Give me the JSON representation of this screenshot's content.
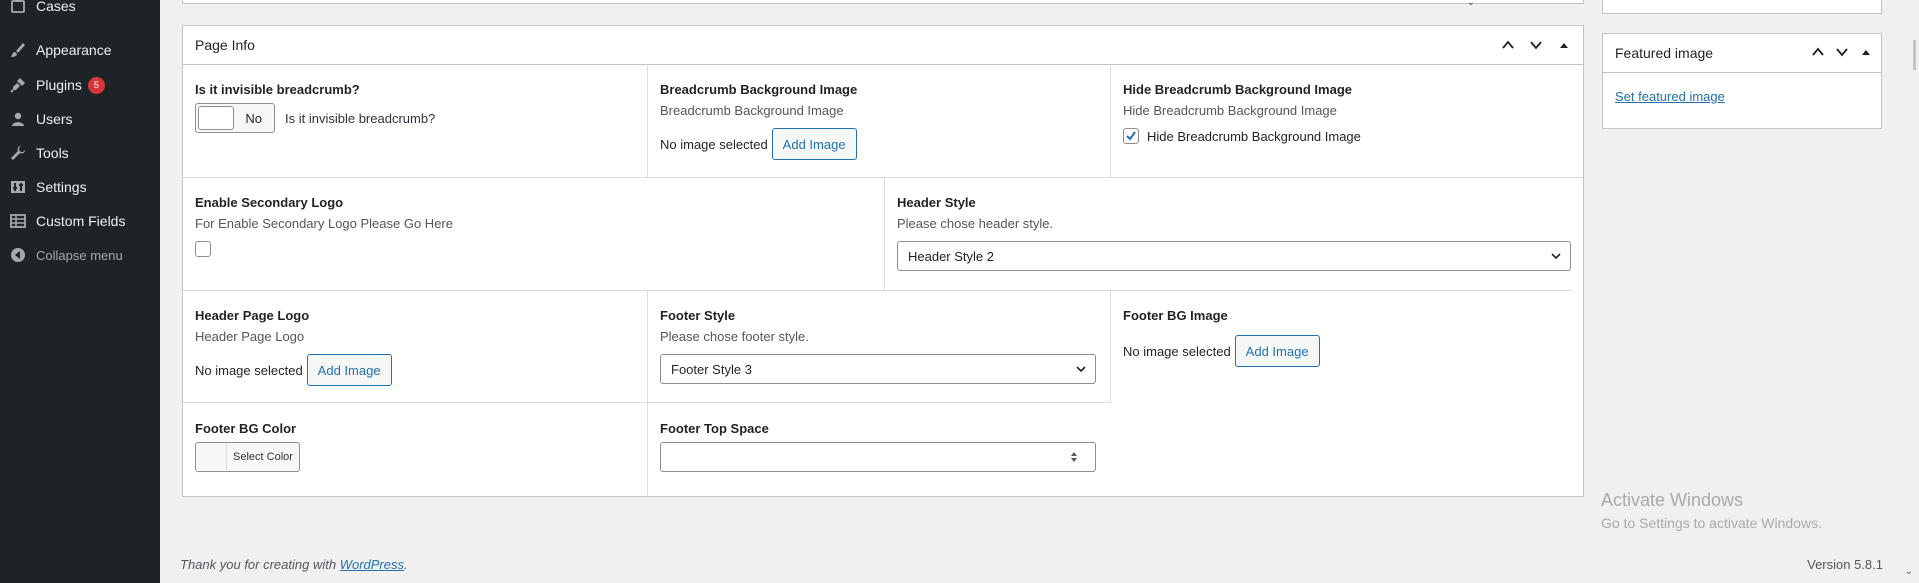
{
  "sidebar": {
    "items": [
      {
        "label": "Cases",
        "icon": "cases-icon"
      },
      {
        "label": "Appearance",
        "icon": "paintbrush-icon"
      },
      {
        "label": "Plugins",
        "icon": "plugin-icon",
        "badge": "5"
      },
      {
        "label": "Users",
        "icon": "users-icon"
      },
      {
        "label": "Tools",
        "icon": "wrench-icon"
      },
      {
        "label": "Settings",
        "icon": "settings-icon"
      },
      {
        "label": "Custom Fields",
        "icon": "table-icon"
      }
    ],
    "collapse_label": "Collapse menu"
  },
  "page_info": {
    "title": "Page Info",
    "invisible_breadcrumb": {
      "title": "Is it invisible breadcrumb?",
      "switch_value": "No",
      "switch_desc": "Is it invisible breadcrumb?"
    },
    "breadcrumb_bg": {
      "title": "Breadcrumb Background Image",
      "desc": "Breadcrumb Background Image",
      "status": "No image selected",
      "button": "Add Image"
    },
    "hide_breadcrumb_bg": {
      "title": "Hide Breadcrumb Background Image",
      "desc": "Hide Breadcrumb Background Image",
      "checkbox_label": "Hide Breadcrumb Background Image",
      "checked": true
    },
    "secondary_logo": {
      "title": "Enable Secondary Logo",
      "desc": "For Enable Secondary Logo Please Go Here",
      "checked": false
    },
    "header_style": {
      "title": "Header Style",
      "desc": "Please chose header style.",
      "selected": "Header Style 2"
    },
    "header_page_logo": {
      "title": "Header Page Logo",
      "desc": "Header Page Logo",
      "status": "No image selected",
      "button": "Add Image"
    },
    "footer_style": {
      "title": "Footer Style",
      "desc": "Please chose footer style.",
      "selected": "Footer Style 3"
    },
    "footer_bg_image": {
      "title": "Footer BG Image",
      "status": "No image selected",
      "button": "Add Image"
    },
    "footer_bg_color": {
      "title": "Footer BG Color",
      "button": "Select Color"
    },
    "footer_top_space": {
      "title": "Footer Top Space",
      "value": ""
    }
  },
  "featured_image": {
    "title": "Featured image",
    "link": "Set featured image"
  },
  "watermark": {
    "line1": "Activate Windows",
    "line2": "Go to Settings to activate Windows."
  },
  "footer": {
    "thanks_prefix": "Thank you for creating with ",
    "thanks_link": "WordPress",
    "thanks_suffix": ".",
    "version": "Version 5.8.1"
  },
  "colors": {
    "sidebar_bg": "#1d2327",
    "accent": "#2271b1",
    "badge": "#d63638"
  }
}
